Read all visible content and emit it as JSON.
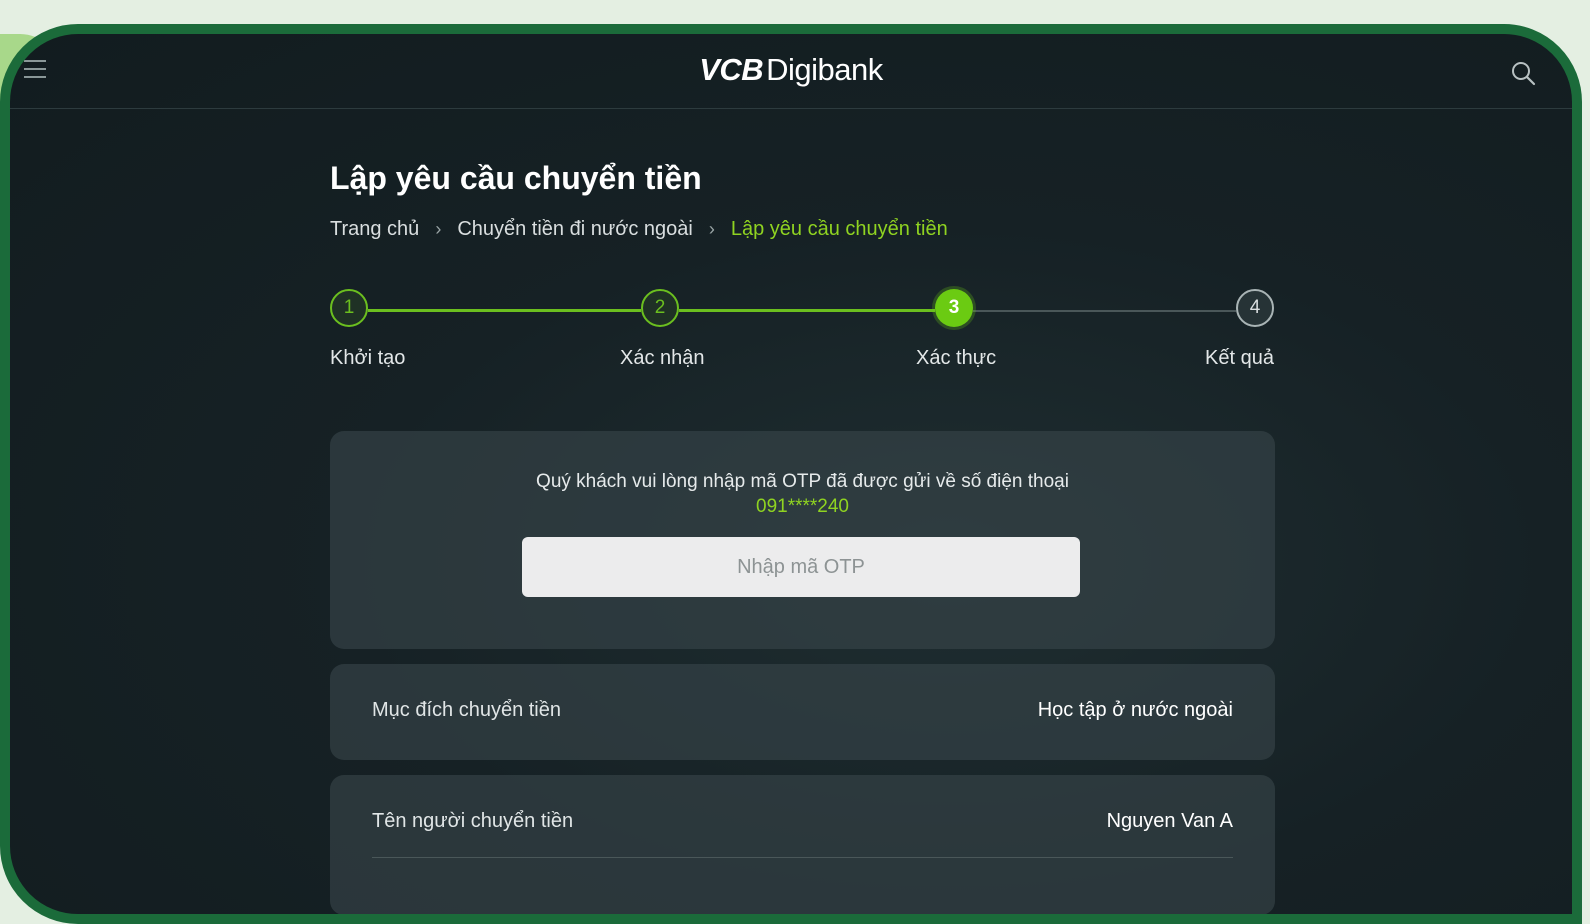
{
  "app": {
    "logo_bold": "VCB",
    "logo_rest": "Digibank"
  },
  "page": {
    "title": "Lập yêu cầu chuyển tiền"
  },
  "breadcrumb": {
    "items": [
      "Trang chủ",
      "Chuyển tiền đi nước ngoài",
      "Lập yêu cầu chuyển tiền"
    ],
    "separator": "›"
  },
  "stepper": {
    "steps": [
      {
        "number": "1",
        "label": "Khởi tạo",
        "state": "done"
      },
      {
        "number": "2",
        "label": "Xác nhận",
        "state": "done"
      },
      {
        "number": "3",
        "label": "Xác thực",
        "state": "active"
      },
      {
        "number": "4",
        "label": "Kết quả",
        "state": "todo"
      }
    ]
  },
  "otp": {
    "message": "Quý khách vui lòng nhập mã OTP đã được gửi về số điện thoại",
    "phone": "091****240",
    "input_value": "",
    "placeholder": "Nhập mã OTP"
  },
  "details": [
    {
      "label": "Mục đích chuyển tiền",
      "value": "Học tập ở nước ngoài"
    },
    {
      "label": "Tên người chuyển tiền",
      "value": "Nguyen Van A"
    }
  ],
  "colors": {
    "accent": "#8fd321",
    "frame": "#1b6b3a",
    "background": "#162125"
  }
}
